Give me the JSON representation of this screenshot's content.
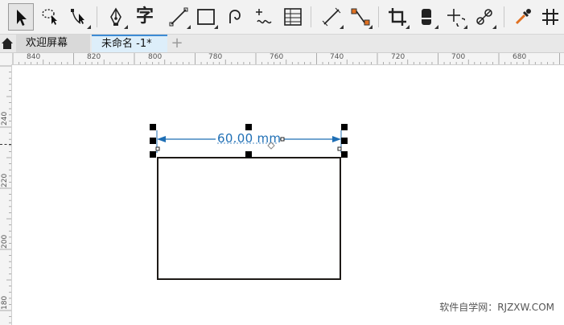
{
  "tools": [
    {
      "name": "pick-tool",
      "icon": "pointer-arrow-icon",
      "active": true
    },
    {
      "name": "freehand-pick-tool",
      "icon": "lasso-pick-icon"
    },
    {
      "name": "shape-tool",
      "icon": "shape-edit-icon"
    },
    {
      "name": "pen-tool",
      "icon": "pen-nib-icon"
    },
    {
      "name": "text-tool",
      "icon": "text-glyph-icon",
      "glyph": "字"
    },
    {
      "name": "line-tool",
      "icon": "two-point-line-icon"
    },
    {
      "name": "rectangle-tool",
      "icon": "rectangle-icon"
    },
    {
      "name": "curve-tool",
      "icon": "bezier-curve-icon"
    },
    {
      "name": "callout-tool",
      "icon": "callout-icon"
    },
    {
      "name": "table-tool",
      "icon": "table-grid-icon"
    },
    {
      "name": "dimension-tool",
      "icon": "dimension-line-icon"
    },
    {
      "name": "connector-tool",
      "icon": "connector-icon"
    },
    {
      "name": "crop-tool",
      "icon": "crop-icon"
    },
    {
      "name": "eraser-tool",
      "icon": "eraser-icon"
    },
    {
      "name": "transform-tool",
      "icon": "move-rotate-icon"
    },
    {
      "name": "blend-tool",
      "icon": "blend-icon"
    },
    {
      "name": "eyedropper-tool",
      "icon": "eyedropper-icon"
    },
    {
      "name": "grid-tool",
      "icon": "grid-hash-icon"
    }
  ],
  "tabs": {
    "welcome": "欢迎屏幕",
    "document": "未命名 -1*",
    "add": "+"
  },
  "ruler": {
    "horizontal_labels": [
      "840",
      "820",
      "800",
      "780",
      "760",
      "740",
      "720",
      "700",
      "680"
    ],
    "vertical_labels": [
      "240",
      "220",
      "200",
      "180"
    ]
  },
  "drawing": {
    "dimension_text": "60.00 mm",
    "rectangle_stroke": "#1e1a17",
    "dimension_color": "#1f6fb5"
  },
  "watermark": "软件自学网：RJZXW.COM",
  "colors": {
    "toolbar_bg": "#f2f2f2",
    "active_tab_bg": "#ddeefa",
    "active_tab_border": "#3d8bd4",
    "connector_accent": "#e07020"
  }
}
